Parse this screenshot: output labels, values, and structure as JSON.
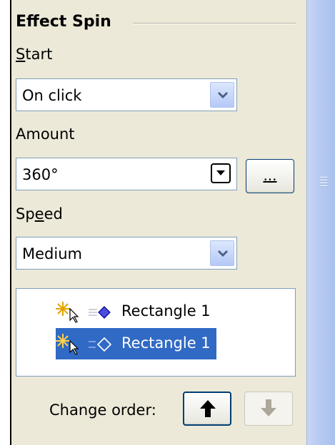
{
  "panel": {
    "section_title": "Effect Spin",
    "start": {
      "label": "Start",
      "value": "On click"
    },
    "amount": {
      "label": "Amount",
      "value": "360°",
      "options_button": "..."
    },
    "speed": {
      "label": "Speed",
      "value": "Medium"
    },
    "effects_list": [
      {
        "label": "Rectangle 1",
        "selected": false
      },
      {
        "label": "Rectangle 1",
        "selected": true
      }
    ],
    "change_order": {
      "label": "Change order:",
      "up_enabled": true,
      "down_enabled": false
    }
  },
  "icons": {
    "dropdown": "chevron-down-icon",
    "spin": "spin-down-icon",
    "effect": "click-trigger-icon",
    "shape": "diamond-shape-icon",
    "up": "arrow-up-icon",
    "down": "arrow-down-icon"
  },
  "colors": {
    "panel_bg": "#ece9d8",
    "selection": "#316ac5",
    "scrollbar": "#b7cbf2"
  }
}
